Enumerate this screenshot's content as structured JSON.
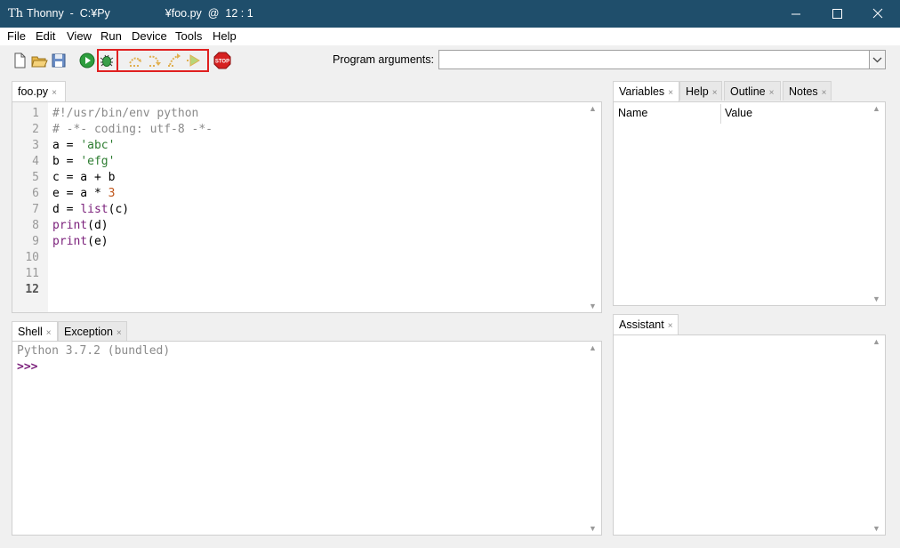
{
  "window": {
    "title_left": "Thonny  -  C:¥Py",
    "title_right": "¥foo.py  @  12 : 1",
    "icon_text": "Th",
    "minimize_label": "—",
    "maximize_label": "☐",
    "close_label": "✕"
  },
  "menu": {
    "items": [
      {
        "label": "File"
      },
      {
        "label": "Edit"
      },
      {
        "label": "View"
      },
      {
        "label": "Run"
      },
      {
        "label": "Device"
      },
      {
        "label": "Tools"
      },
      {
        "label": "Help"
      }
    ]
  },
  "toolbar": {
    "program_arguments_label": "Program arguments:",
    "program_arguments_value": "",
    "icons": [
      "new-file-icon",
      "open-file-icon",
      "save-icon",
      "run-icon",
      "debug-icon",
      "step-over-icon",
      "step-into-icon",
      "step-out-icon",
      "resume-icon",
      "stop-icon"
    ],
    "stop_text": "STOP",
    "colors": {
      "run": "#2e9e3e",
      "stop": "#d62020",
      "highlight": "#e02020",
      "step": "#e0b050"
    }
  },
  "editor": {
    "tab_label": "foo.py",
    "close_glyph": "×",
    "current_line": 12,
    "lines": [
      {
        "num": "1",
        "tokens": [
          {
            "t": "#!/usr/bin/env python",
            "c": "c-comment"
          }
        ]
      },
      {
        "num": "2",
        "tokens": [
          {
            "t": "# -*- coding: utf-8 -*-",
            "c": "c-comment"
          }
        ]
      },
      {
        "num": "3",
        "tokens": [
          {
            "t": "a = ",
            "c": ""
          },
          {
            "t": "'abc'",
            "c": "c-str"
          }
        ]
      },
      {
        "num": "4",
        "tokens": [
          {
            "t": "b = ",
            "c": ""
          },
          {
            "t": "'efg'",
            "c": "c-str"
          }
        ]
      },
      {
        "num": "5",
        "tokens": [
          {
            "t": "c = a + b",
            "c": ""
          }
        ]
      },
      {
        "num": "6",
        "tokens": [
          {
            "t": "e = a * ",
            "c": ""
          },
          {
            "t": "3",
            "c": "c-num"
          }
        ]
      },
      {
        "num": "7",
        "tokens": [
          {
            "t": "d = ",
            "c": ""
          },
          {
            "t": "list",
            "c": "c-builtin"
          },
          {
            "t": "(c)",
            "c": ""
          }
        ]
      },
      {
        "num": "8",
        "tokens": [
          {
            "t": "print",
            "c": "c-builtin"
          },
          {
            "t": "(d)",
            "c": ""
          }
        ]
      },
      {
        "num": "9",
        "tokens": [
          {
            "t": "print",
            "c": "c-builtin"
          },
          {
            "t": "(e)",
            "c": ""
          }
        ]
      },
      {
        "num": "10",
        "tokens": []
      },
      {
        "num": "11",
        "tokens": []
      },
      {
        "num": "12",
        "tokens": []
      }
    ]
  },
  "right_tabs": {
    "tabs": [
      {
        "label": "Variables",
        "active": true
      },
      {
        "label": "Help",
        "active": false
      },
      {
        "label": "Outline",
        "active": false
      },
      {
        "label": "Notes",
        "active": false
      }
    ],
    "variables": {
      "col_name": "Name",
      "col_value": "Value"
    }
  },
  "shell": {
    "tabs": [
      {
        "label": "Shell",
        "active": true
      },
      {
        "label": "Exception",
        "active": false
      }
    ],
    "banner": "Python 3.7.2 (bundled)",
    "prompt": ">>>"
  },
  "assistant": {
    "tab_label": "Assistant"
  }
}
